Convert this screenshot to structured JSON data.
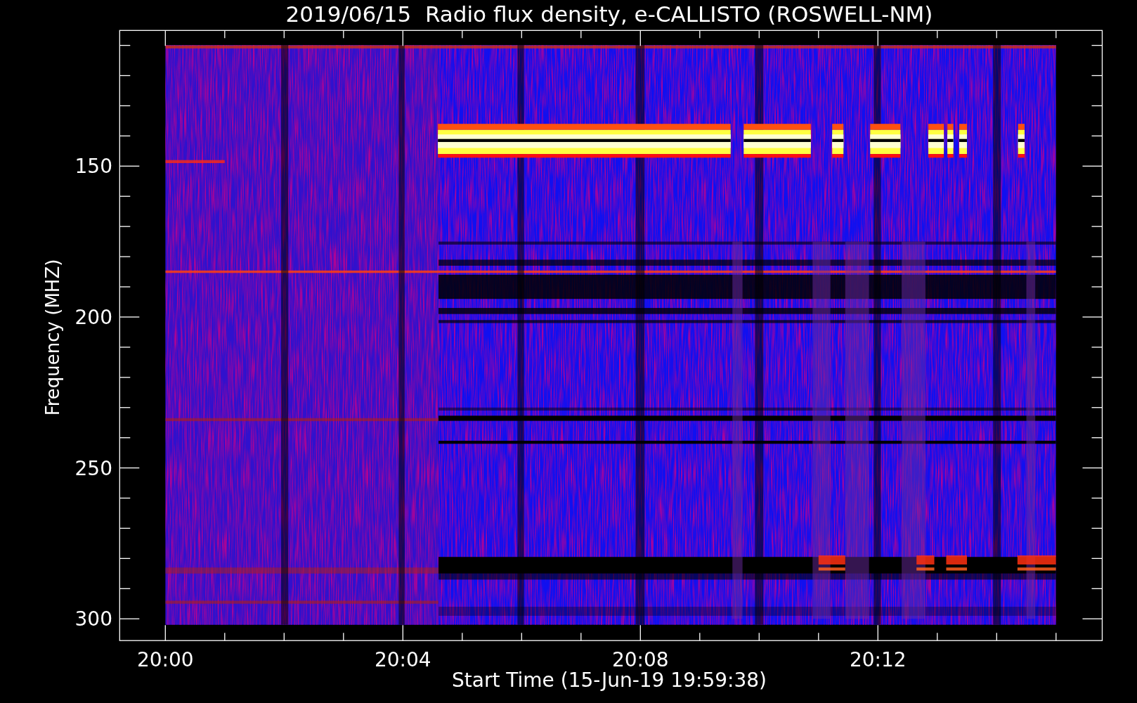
{
  "plot": {
    "title": "2019/06/15  Radio flux density, e-CALLISTO (ROSWELL-NM)",
    "ylabel": "Frequency (MHZ)",
    "xlabel": "Start Time (15-Jun-19 19:59:38)",
    "yticks": [
      "150",
      "200",
      "250",
      "300"
    ],
    "xticks": [
      "20:00",
      "20:04",
      "20:08",
      "20:12"
    ]
  }
}
